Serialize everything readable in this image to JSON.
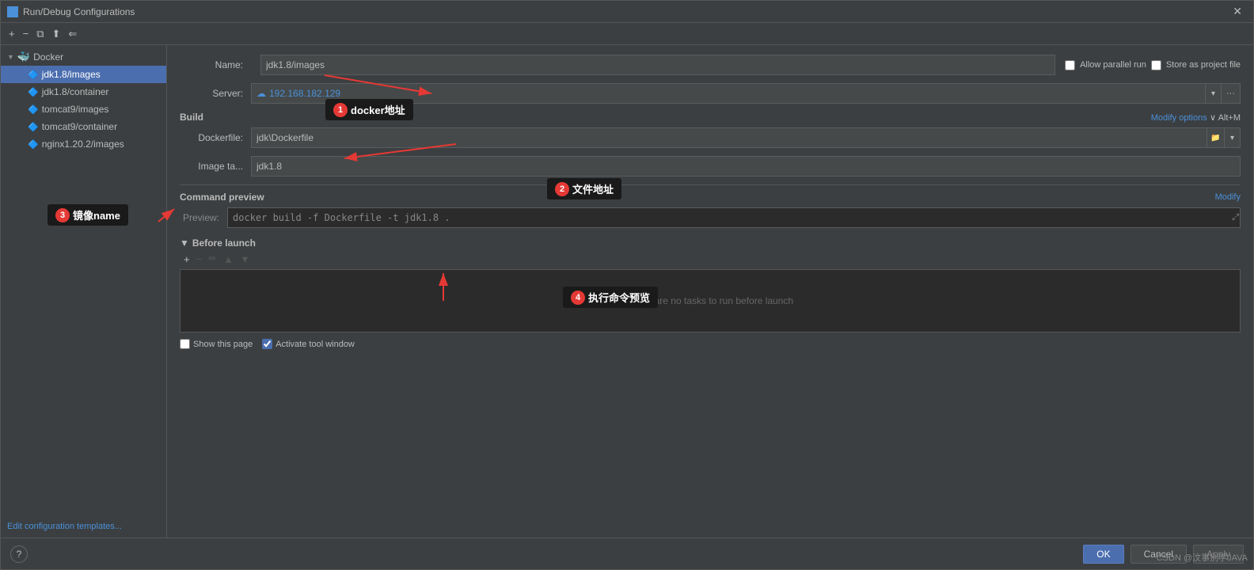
{
  "window": {
    "title": "Run/Debug Configurations"
  },
  "toolbar": {
    "add_label": "+",
    "remove_label": "−",
    "copy_label": "⧉",
    "move_up_label": "⬆",
    "move_right_label": "➕"
  },
  "sidebar": {
    "docker_label": "Docker",
    "items": [
      {
        "label": "jdk1.8/images",
        "selected": true
      },
      {
        "label": "jdk1.8/container"
      },
      {
        "label": "tomcat9/images"
      },
      {
        "label": "tomcat9/container"
      },
      {
        "label": "nginx1.20.2/images"
      }
    ],
    "edit_config_link": "Edit configuration templates..."
  },
  "form": {
    "name_label": "Name:",
    "name_value": "jdk1.8/images",
    "allow_parallel_label": "Allow parallel run",
    "store_as_project_label": "Store as project file",
    "server_label": "Server:",
    "server_value": "192.168.182.129",
    "build_label": "Build",
    "modify_options_label": "Modify options",
    "modify_options_shortcut": "Alt+M",
    "dockerfile_label": "Dockerfile:",
    "dockerfile_value": "jdk\\Dockerfile",
    "image_tag_label": "Image ta...",
    "image_tag_value": "jdk1.8",
    "command_preview_label": "Command preview",
    "modify_label": "Modify",
    "preview_label": "Preview:",
    "preview_value": "docker build -f Dockerfile -t jdk1.8 .",
    "before_launch_label": "Before launch",
    "no_tasks_label": "There are no tasks to run before launch",
    "show_this_page_label": "Show this page",
    "activate_tool_window_label": "Activate tool window"
  },
  "buttons": {
    "ok_label": "OK",
    "cancel_label": "Cancel",
    "apply_label": "Apply"
  },
  "annotations": {
    "a1_number": "1",
    "a1_text": "docker地址",
    "a2_number": "2",
    "a2_text": "文件地址",
    "a3_number": "3",
    "a3_text": "镜像name",
    "a4_number": "4",
    "a4_text": "执行命令预览"
  },
  "watermark": {
    "text": "CSDN @汶事别学JAVA"
  }
}
